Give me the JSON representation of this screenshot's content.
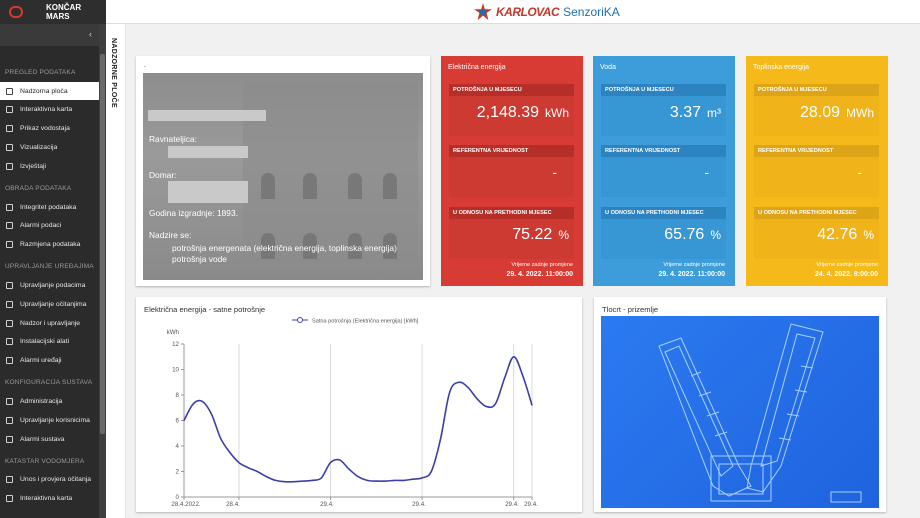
{
  "brand": {
    "left_line1": "KONČAR",
    "left_line2": "MARS",
    "center_title": "KARLOVAC",
    "center_sub": "SenzoriKA"
  },
  "sidebar": {
    "toggle": "‹",
    "sections": [
      {
        "title": "PREGLED PODATAKA",
        "items": [
          "Nadzorna ploča",
          "Interaktivna karta",
          "Prikaz vodostaja",
          "Vizualizacija",
          "Izvještaji"
        ]
      },
      {
        "title": "OBRADA PODATAKA",
        "items": [
          "Integritet podataka",
          "Alarmi podaci",
          "Razmjena podataka"
        ]
      },
      {
        "title": "UPRAVLJANJE UREĐAJIMA",
        "items": [
          "Upravljanje podacima",
          "Upravljanje očitanjima",
          "Nadzor i upravljanje",
          "Instalacijski alati",
          "Alarmi uređaji"
        ]
      },
      {
        "title": "KONFIGURACIJA SUSTAVA",
        "items": [
          "Administracija",
          "Upravljanje korisnicima",
          "Alarmi sustava"
        ]
      },
      {
        "title": "KATASTAR VODOMJERA",
        "items": [
          "Unos i provjera očitanja",
          "Interaktivna karta"
        ]
      }
    ]
  },
  "vertical_tab": "NADZORNE PLOČE",
  "info": {
    "dot": ".",
    "ravnateljica": "Ravnateljica:",
    "domar": "Domar:",
    "godina": "Godina izgradnje: 1893.",
    "nadzire": "Nadzire se:",
    "nadzire_1": "potrošnja energenata (električna energija, toplinska energija)",
    "nadzire_2": "potrošnja vode"
  },
  "cards": [
    {
      "title": "Električna energija",
      "lbl1": "POTROŠNJA U MJESECU",
      "val1": "2,148.39",
      "unit1": "kWh",
      "lbl2": "REFERENTNA VRIJEDNOST",
      "val2": "-",
      "lbl3": "U ODNOSU NA PRETHODNI MJESEC",
      "val3": "75.22",
      "unit3": "%",
      "ts_label": "Vrijeme zadnje promjene",
      "ts": "29. 4. 2022. 11:00:00",
      "color": "#d83b33"
    },
    {
      "title": "Voda",
      "lbl1": "POTROŠNJA U MJESECU",
      "val1": "3.37",
      "unit1": "m³",
      "lbl2": "REFERENTNA VRIJEDNOST",
      "val2": "-",
      "lbl3": "U ODNOSU NA PRETHODNI MJESEC",
      "val3": "65.76",
      "unit3": "%",
      "ts_label": "Vrijeme zadnje promjene",
      "ts": "29. 4. 2022. 11:00:00",
      "color": "#3d9ddb"
    },
    {
      "title": "Toplinska energija",
      "lbl1": "POTROŠNJA U MJESECU",
      "val1": "28.09",
      "unit1": "MWh",
      "lbl2": "REFERENTNA VRIJEDNOST",
      "val2": "-",
      "lbl3": "U ODNOSU NA PRETHODNI MJESEC",
      "val3": "42.76",
      "unit3": "%",
      "ts_label": "Vrijeme zadnje promjene",
      "ts": "24. 4. 2022. 8:00:00",
      "color": "#f5b919"
    }
  ],
  "chart_title": "Električna energija - satne potrošnje",
  "plan_title": "Tlocrt - prizemlje",
  "chart_data": {
    "type": "line",
    "legend": "Satna potrošnja (Električna energija) [kWh]",
    "ylabel": "kWh",
    "ylim": [
      0,
      12
    ],
    "yticks": [
      0,
      2,
      4,
      6,
      8,
      10,
      12
    ],
    "xlim": [
      0,
      38
    ],
    "xticks": [
      {
        "x": 0,
        "label": "28.4.2022."
      },
      {
        "x": 6,
        "label": "28.4."
      },
      {
        "x": 16,
        "label": "29.4."
      },
      {
        "x": 26,
        "label": "29.4."
      },
      {
        "x": 36,
        "label": "29.4."
      },
      {
        "x": 38,
        "label": "29.4."
      }
    ],
    "x": [
      0,
      1,
      2,
      3,
      4,
      5,
      6,
      7,
      8,
      9,
      10,
      11,
      12,
      13,
      14,
      15,
      16,
      17,
      18,
      19,
      20,
      21,
      22,
      23,
      24,
      25,
      26,
      27,
      28,
      29,
      30,
      31,
      32,
      33,
      34,
      35,
      36,
      37,
      38
    ],
    "y": [
      6.0,
      7.3,
      7.5,
      6.5,
      4.6,
      3.5,
      2.7,
      2.3,
      2.0,
      1.6,
      1.3,
      1.2,
      1.2,
      1.25,
      1.3,
      1.5,
      2.7,
      2.9,
      2.2,
      1.6,
      1.3,
      1.25,
      1.25,
      1.3,
      1.3,
      1.4,
      1.5,
      2.0,
      4.5,
      8.2,
      9.0,
      8.6,
      7.7,
      7.1,
      7.3,
      9.3,
      11.0,
      9.5,
      7.2
    ]
  },
  "colors": {
    "line": "#3c3fa8",
    "sidebar_bg": "#2b2b2b",
    "accent_red": "#d83b33",
    "accent_blue": "#3d9ddb",
    "accent_yellow": "#f5b919"
  }
}
